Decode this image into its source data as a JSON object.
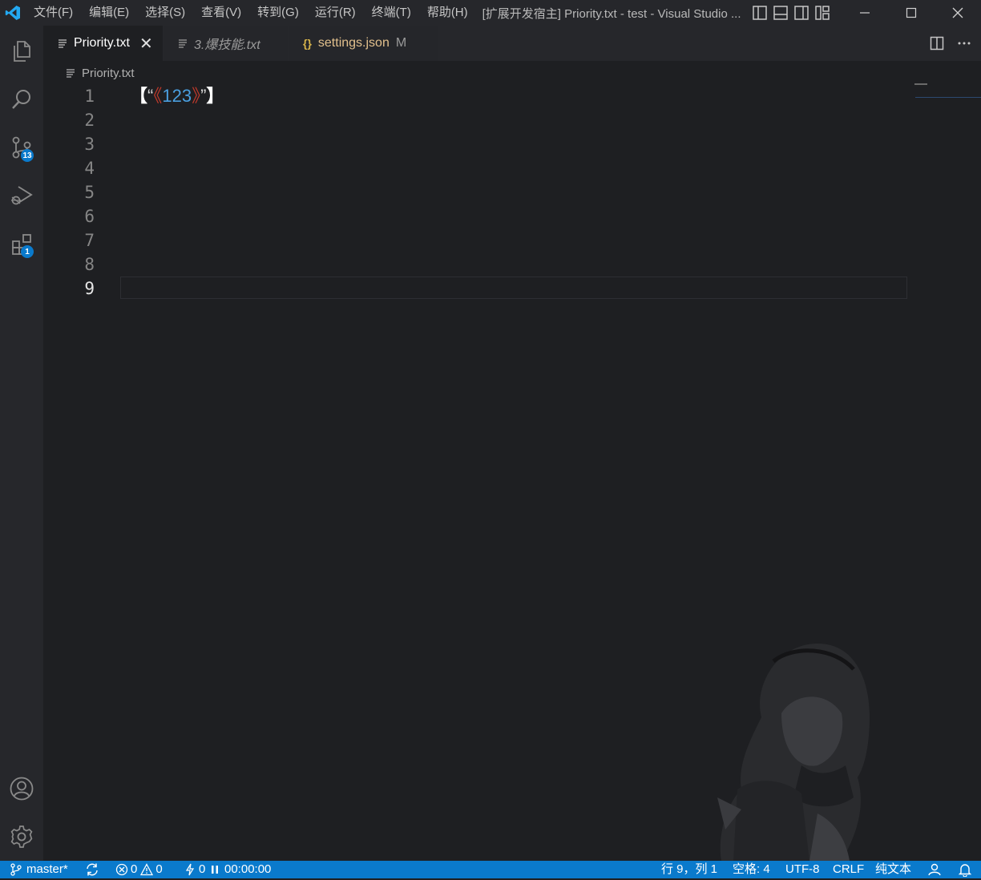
{
  "titlebar": {
    "menu": [
      "文件(F)",
      "编辑(E)",
      "选择(S)",
      "查看(V)",
      "转到(G)",
      "运行(R)",
      "终端(T)",
      "帮助(H)"
    ],
    "window_title": "[扩展开发宿主] Priority.txt - test - Visual Studio ..."
  },
  "activity": {
    "scm_badge": "13",
    "extensions_badge": "1"
  },
  "tabs": [
    {
      "label": "Priority.txt",
      "close": "✕"
    },
    {
      "label": "3.爆技能.txt"
    },
    {
      "label": "settings.json",
      "modified": "M"
    }
  ],
  "breadcrumb": {
    "file": "Priority.txt"
  },
  "editor": {
    "line_numbers": [
      "1",
      "2",
      "3",
      "4",
      "5",
      "6",
      "7",
      "8",
      "9"
    ],
    "line1": {
      "open_bracket": "【",
      "open_quote": "“",
      "open_angle": "《",
      "number": "123",
      "close_angle": "》",
      "close_quote": "”",
      "close_bracket": "】"
    }
  },
  "statusbar": {
    "branch": "master*",
    "errors": "0",
    "warnings": "0",
    "ports": "0",
    "timer": "00:00:00",
    "position": "行 9，列 1",
    "indent": "空格: 4",
    "encoding": "UTF-8",
    "eol": "CRLF",
    "language": "纯文本"
  },
  "colors": {
    "accent": "#0a7acc",
    "editor_bg": "#1e1f22",
    "chrome_bg": "#26272b"
  }
}
